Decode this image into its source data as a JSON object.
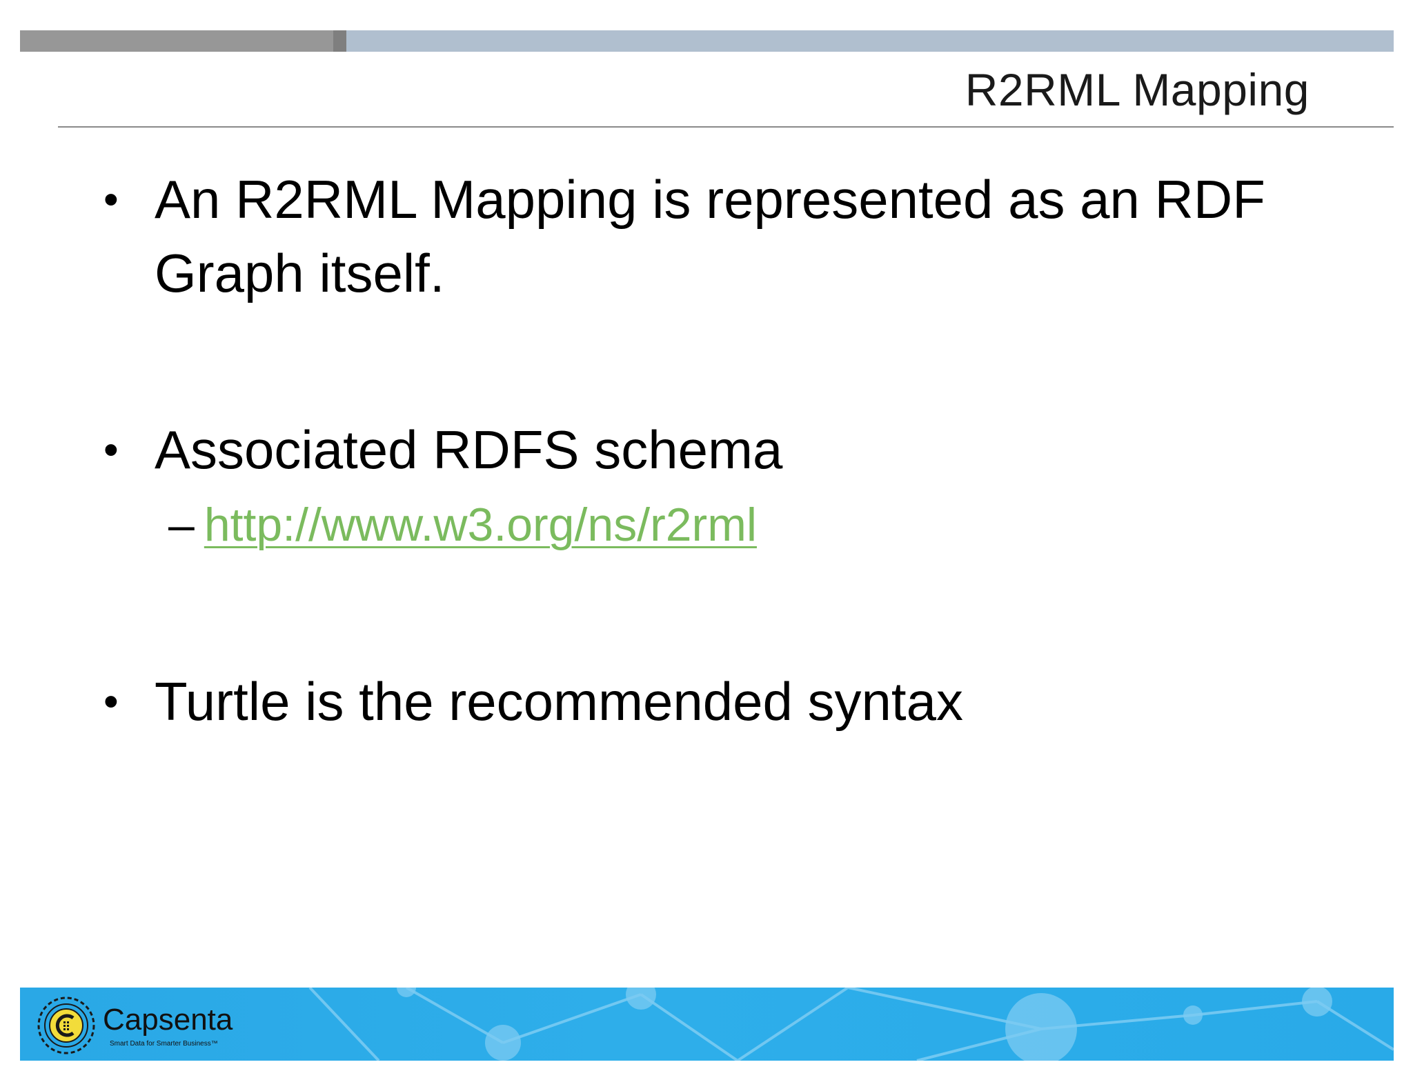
{
  "slide": {
    "title": "R2RML Mapping",
    "bullets": [
      {
        "marker": "•",
        "text": "An R2RML Mapping is represented as an RDF Graph itself."
      },
      {
        "marker": "•",
        "text": "Associated RDFS schema"
      },
      {
        "marker": "•",
        "text": "Turtle is the recommended syntax"
      }
    ],
    "sub_bullet": {
      "marker": "–",
      "link_text": "http://www.w3.org/ns/r2rml"
    }
  },
  "footer": {
    "brand": "Capsenta",
    "tagline": "Smart Data for Smarter Business™",
    "logo_icon": "capsenta-logo-icon"
  },
  "colors": {
    "top_bar_dark": "#979797",
    "top_bar_light": "#b0bfcf",
    "link": "#7bbb5e",
    "footer_blue": "#2aa8e6"
  }
}
